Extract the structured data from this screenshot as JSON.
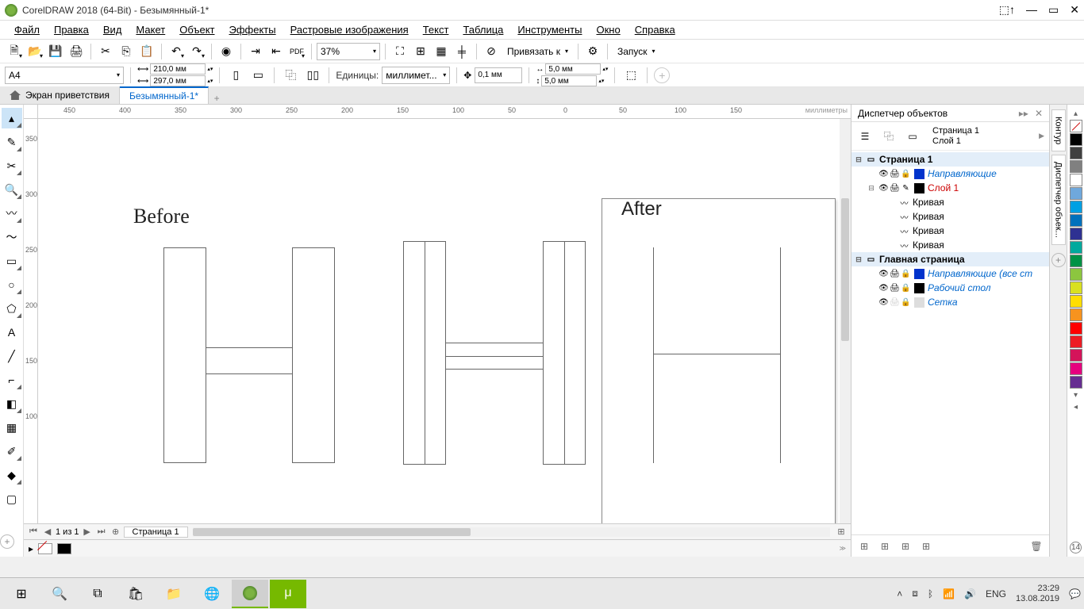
{
  "title": "CorelDRAW 2018 (64-Bit) - Безымянный-1*",
  "menu": [
    "Файл",
    "Правка",
    "Вид",
    "Макет",
    "Объект",
    "Эффекты",
    "Растровые изображения",
    "Текст",
    "Таблица",
    "Инструменты",
    "Окно",
    "Справка"
  ],
  "toolbar": {
    "zoom": "37%",
    "snap_label": "Привязать к",
    "launch_label": "Запуск"
  },
  "propbar": {
    "page_preset": "A4",
    "width": "210,0 мм",
    "height": "297,0 мм",
    "units_label": "Единицы:",
    "units": "миллимет...",
    "nudge": "0,1 мм",
    "dupx": "5,0 мм",
    "dupy": "5,0 мм"
  },
  "tabs": {
    "welcome": "Экран приветствия",
    "doc": "Безымянный-1*"
  },
  "ruler": {
    "unit_label": "миллиметры",
    "h_ticks": [
      "450",
      "400",
      "350",
      "300",
      "250",
      "200",
      "150",
      "100",
      "50",
      "0",
      "50",
      "100",
      "150"
    ],
    "v_ticks": [
      "350",
      "300",
      "250",
      "200",
      "150",
      "100"
    ]
  },
  "canvas": {
    "before_label": "Before",
    "after_label": "After"
  },
  "page_nav": {
    "page_of": "1  из  1",
    "page_tab": "Страница 1"
  },
  "docker": {
    "title": "Диспетчер объектов",
    "page_line": "Страница 1",
    "layer_line": "Слой 1",
    "tree": {
      "page1": "Страница 1",
      "guides": "Направляющие",
      "layer1": "Слой 1",
      "curve": "Кривая",
      "master": "Главная страница",
      "guides_all": "Направляющие (все ст",
      "desktop": "Рабочий стол",
      "grid": "Сетка"
    }
  },
  "side_tabs": {
    "outline": "Контур",
    "objmgr": "Диспетчер объек..."
  },
  "palette": [
    "#000000",
    "#1a1a1a",
    "#ffffff",
    "#00a0e3",
    "#d4145a",
    "#e6007e",
    "#f7931e",
    "#ffde00",
    "#8cc63f",
    "#009245",
    "#00a99d",
    "#0071bc",
    "#2e3192",
    "#662d91",
    "#ff0000",
    "#ff7f27",
    "#ffff00",
    "#00ff00",
    "#0000ff"
  ],
  "taskbar": {
    "lang": "ENG",
    "time": "23:29",
    "date": "13.08.2019"
  }
}
